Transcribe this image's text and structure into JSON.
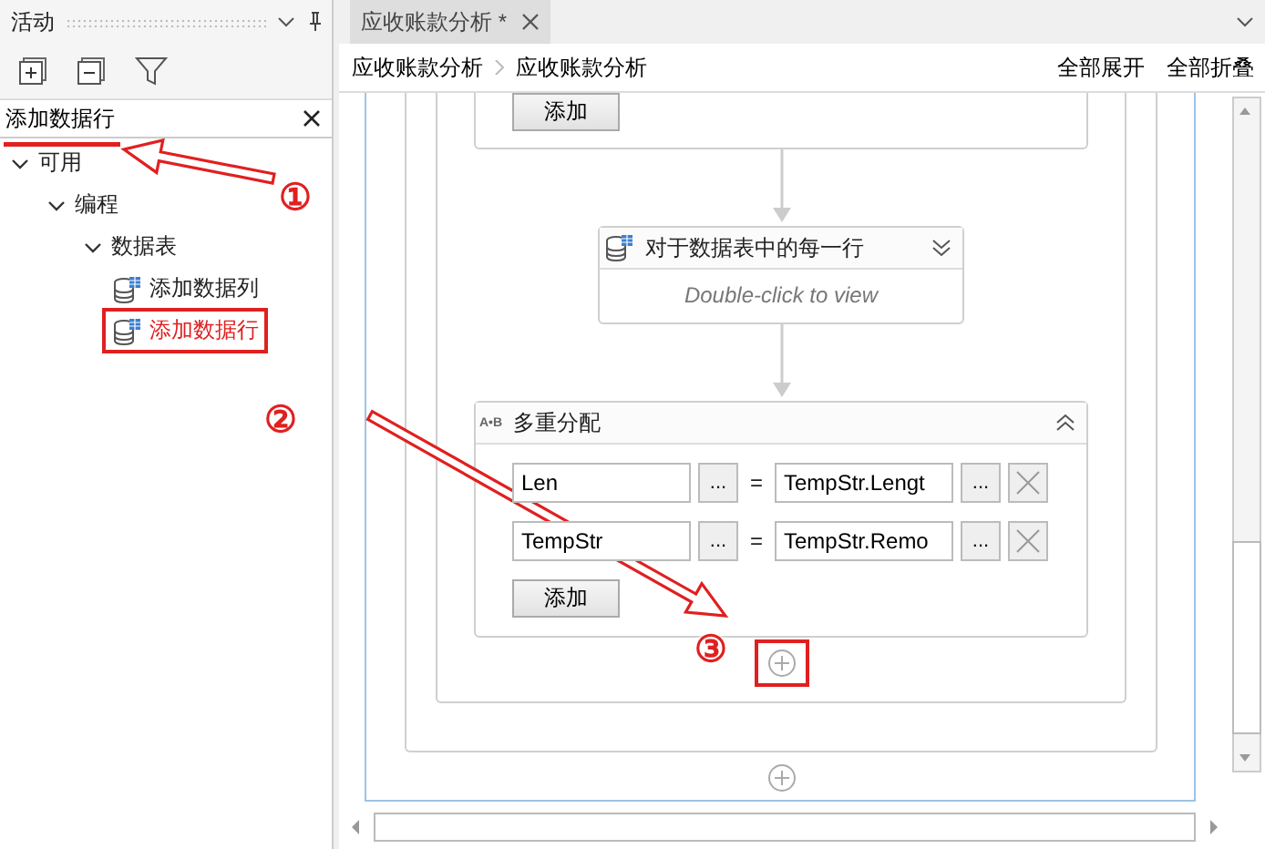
{
  "activities_panel": {
    "title": "活动",
    "search": {
      "value": "添加数据行"
    },
    "tree": [
      {
        "label": "可用",
        "expanded": true,
        "children": [
          {
            "label": "编程",
            "expanded": true,
            "children": [
              {
                "label": "数据表",
                "expanded": true,
                "children": [
                  {
                    "label": "添加数据列",
                    "kind": "activity",
                    "highlighted": false
                  },
                  {
                    "label": "添加数据行",
                    "kind": "activity",
                    "highlighted": true
                  }
                ]
              }
            ]
          }
        ]
      }
    ]
  },
  "document_tab": {
    "title": "应收账款分析 *"
  },
  "breadcrumb": [
    "应收账款分析",
    "应收账款分析"
  ],
  "actions": [
    "全部展开",
    "全部折叠"
  ],
  "designer": {
    "top_card": {
      "add_button": "添加"
    },
    "for_each": {
      "title": "对于数据表中的每一行",
      "hint": "Double-click to view"
    },
    "multiple_assign": {
      "icon": "A•B",
      "title": "多重分配",
      "rows": [
        {
          "target": "Len",
          "target_browse": "...",
          "equals": "=",
          "value": "TempStr.Lengt",
          "value_browse": "..."
        },
        {
          "target": "TempStr",
          "target_browse": "...",
          "equals": "=",
          "value": "TempStr.Remo",
          "value_browse": "..."
        }
      ],
      "add_button": "添加"
    },
    "insert_points": [
      {
        "highlighted": true
      },
      {
        "highlighted": false
      }
    ]
  },
  "annotations": [
    {
      "label": "①"
    },
    {
      "label": "②"
    },
    {
      "label": "③"
    }
  ]
}
